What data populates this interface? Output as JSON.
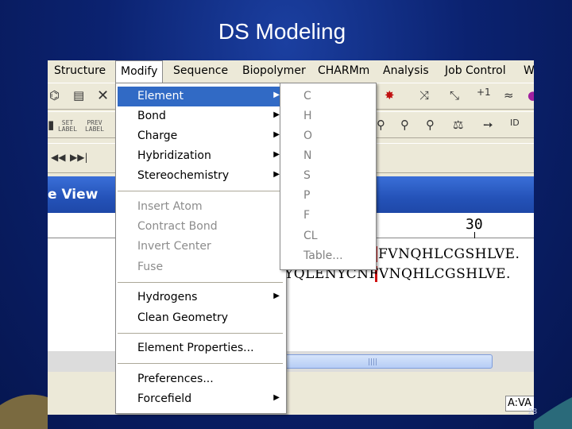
{
  "slide": {
    "title": "DS Modeling",
    "page_number": "28"
  },
  "menubar": {
    "items": [
      "Structure",
      "Modify",
      "Sequence",
      "Biopolymer",
      "CHARMm",
      "Analysis",
      "Job Control",
      "W"
    ],
    "active": "Modify"
  },
  "toolbar": {
    "set_label_top": "SET",
    "set_label_bottom": "LABEL",
    "prev_label_top": "PREV",
    "prev_label_bottom": "LABEL",
    "plus_one": "+1"
  },
  "view_panel": {
    "title": "e View"
  },
  "ruler": {
    "position": "30"
  },
  "sequence": {
    "line1": "FVNQHLCGSHLVE.",
    "line2": "YQLENYCNFVNQHLCGSHLVE."
  },
  "status": {
    "field_value": "A:VA"
  },
  "modify_menu": {
    "items": [
      {
        "label": "Element",
        "submenu": true,
        "enabled": true,
        "highlight": true
      },
      {
        "label": "Bond",
        "submenu": true,
        "enabled": true
      },
      {
        "label": "Charge",
        "submenu": true,
        "enabled": true
      },
      {
        "label": "Hybridization",
        "submenu": true,
        "enabled": true
      },
      {
        "label": "Stereochemistry",
        "submenu": true,
        "enabled": true
      },
      {
        "label": "Insert Atom",
        "enabled": false
      },
      {
        "label": "Contract Bond",
        "enabled": false
      },
      {
        "label": "Invert Center",
        "enabled": false
      },
      {
        "label": "Fuse",
        "enabled": false
      },
      {
        "label": "Hydrogens",
        "submenu": true,
        "enabled": true
      },
      {
        "label": "Clean Geometry",
        "enabled": true
      },
      {
        "label": "Element Properties...",
        "enabled": true
      },
      {
        "label": "Preferences...",
        "enabled": true
      },
      {
        "label": "Forcefield",
        "submenu": true,
        "enabled": true
      }
    ]
  },
  "element_submenu": {
    "items": [
      "C",
      "H",
      "O",
      "N",
      "S",
      "P",
      "F",
      "CL",
      "Table..."
    ]
  },
  "colors": {
    "menu_highlight": "#316ac5",
    "slide_background": "#0b2270",
    "viewbar": "#2452b8"
  }
}
